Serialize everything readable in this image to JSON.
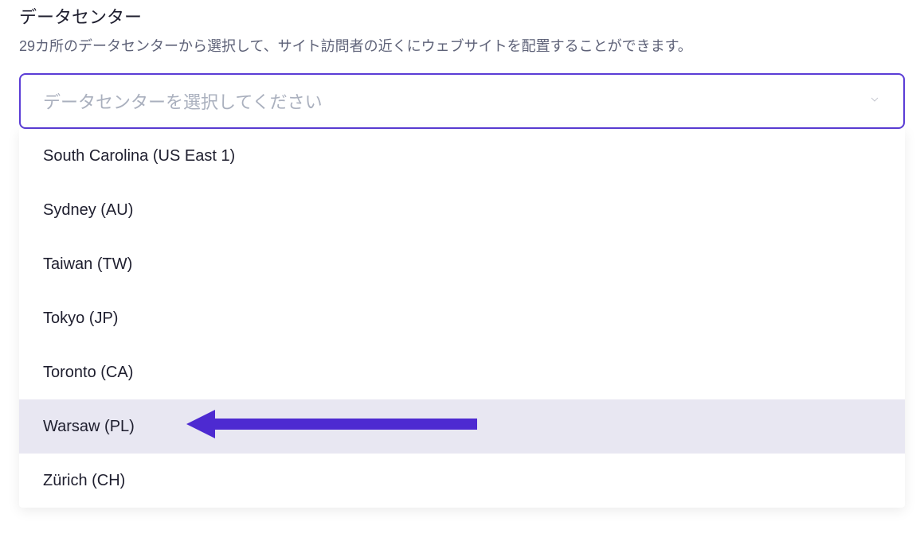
{
  "heading": "データセンター",
  "description": "29カ所のデータセンターから選択して、サイト訪問者の近くにウェブサイトを配置することができます。",
  "select": {
    "placeholder": "データセンターを選択してください"
  },
  "dropdown": {
    "items": [
      {
        "label": "South Carolina (US East 1)",
        "highlighted": false
      },
      {
        "label": "Sydney (AU)",
        "highlighted": false
      },
      {
        "label": "Taiwan (TW)",
        "highlighted": false
      },
      {
        "label": "Tokyo (JP)",
        "highlighted": false
      },
      {
        "label": "Toronto (CA)",
        "highlighted": false
      },
      {
        "label": "Warsaw (PL)",
        "highlighted": true
      },
      {
        "label": "Zürich (CH)",
        "highlighted": false
      }
    ]
  },
  "colors": {
    "accent": "#5b3dd6",
    "arrow": "#4d2ad1"
  }
}
